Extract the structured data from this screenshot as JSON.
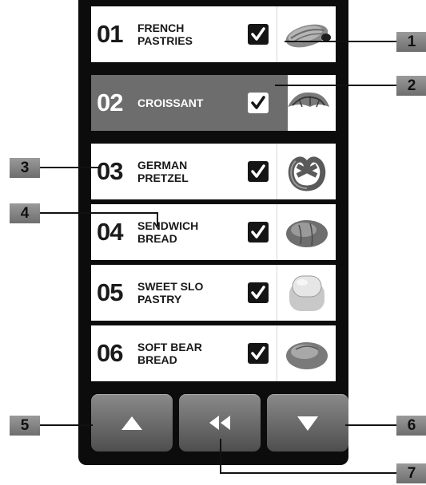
{
  "list": {
    "items": [
      {
        "number": "01",
        "name": "FRENCH\nPASTRIES",
        "checked": true,
        "selected": false,
        "image": "pastry-image"
      },
      {
        "number": "02",
        "name": "CROISSANT",
        "checked": true,
        "selected": true,
        "image": "croissant-image"
      },
      {
        "number": "03",
        "name": "GERMAN\nPRETZEL",
        "checked": true,
        "selected": false,
        "image": "pretzel-image"
      },
      {
        "number": "04",
        "name": "SENDWICH\nBREAD",
        "checked": true,
        "selected": false,
        "image": "bread-roll-image"
      },
      {
        "number": "05",
        "name": "SWEET SLO\nPASTRY",
        "checked": true,
        "selected": false,
        "image": "sweet-bread-image"
      },
      {
        "number": "06",
        "name": "SOFT BEAR\nBREAD",
        "checked": true,
        "selected": false,
        "image": "bun-image"
      }
    ]
  },
  "nav": {
    "up_icon": "triangle-up-icon",
    "back_icon": "double-chevron-left-icon",
    "down_icon": "triangle-down-icon"
  },
  "callouts": [
    "1",
    "2",
    "3",
    "4",
    "5",
    "6",
    "7"
  ],
  "colors": {
    "frame": "#0c0c0c",
    "row_bg": "#ffffff",
    "selected_row_bg": "#6d6d6d",
    "button": "#6b6b6b",
    "callout": "#8a8a8a"
  }
}
